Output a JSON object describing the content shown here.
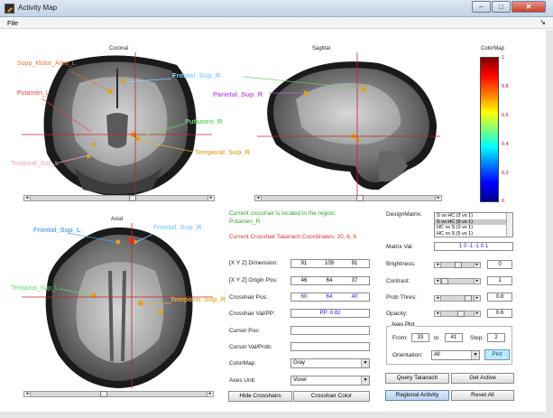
{
  "window": {
    "title": "Activity Map",
    "minimize_glyph": "–",
    "maximize_glyph": "□",
    "close_glyph": "✕"
  },
  "menu": {
    "file_label": "File",
    "overflow_glyph": "↘"
  },
  "views": {
    "coronal": {
      "title": "Coronal",
      "labels": {
        "supp_motor": "Supp_Motor_Area_L",
        "frontal_sup_r": "Frontal_Sup_R",
        "putamen_l": "Putamen_L",
        "putamen_r": "Putamen_R",
        "temporal_sup_r": "Temporal_Sup_R",
        "temporal_sup_l": "Temporal_Sup_L"
      }
    },
    "sagittal": {
      "title": "Sagittal",
      "labels": {
        "parietal_sup_r": "Parietal_Sup_R"
      }
    },
    "axial": {
      "title": "Axial",
      "labels": {
        "frontal_sup_l": "Frontal_Sup_L",
        "frontal_sup_r": "Frontal_Sup_R",
        "temporal_sup_l": "Temporal_Sup_L",
        "temporal_sup_r": "Temporal_Sup_R"
      }
    }
  },
  "colormap": {
    "title": "ColorMap",
    "ticks": [
      "1",
      "0.8",
      "0.6",
      "0.4",
      "0.2",
      "0"
    ],
    "colors": {
      "top": "#800000",
      "bottom": "#00008f"
    }
  },
  "messages": {
    "region_line1": "Current crosshair is located in the region:",
    "region_line2": "Putamen_R",
    "talairach": "Current Crosshair Talairach Coordinates: 20, 6, 6"
  },
  "left_panel": {
    "dimension_label": "[X Y Z] Dimension:",
    "dimension_values": [
      "91",
      "109",
      "91"
    ],
    "origin_label": "[X Y Z] Origin Pos:",
    "origin_values": [
      "46",
      "64",
      "37"
    ],
    "crosshair_pos_label": "Crosshair Pos:",
    "crosshair_pos_values": [
      "60",
      "64",
      "40"
    ],
    "crosshair_val_label": "Crosshair Val/PP:",
    "crosshair_val_value": "PP: 0.82",
    "cursor_pos_label": "Cursor Pos:",
    "cursor_val_label": "Cursor Val/Prob:",
    "colormap_label": "ColorMap:",
    "colormap_value": "Gray",
    "axes_unit_label": "Axes Unit:",
    "axes_unit_value": "Voxel",
    "hide_crosshairs_label": "Hide Crosshairs",
    "crosshair_color_label": "Crosshair Color"
  },
  "right_panel": {
    "design_matrix_label": "DesignMatrix:",
    "design_matrix_options": [
      "S vs HC (3 vs 1)",
      "S vs HC (5 vs 1)",
      "HC vs S (3 vs 1)",
      "HC vs S (5 vs 1)"
    ],
    "matrix_val_label": "Matrix Val:",
    "matrix_val_value": "1 0 -1 -1 0 1",
    "brightness_label": "Brightness:",
    "brightness_value": "0",
    "contrast_label": "Contrast:",
    "contrast_value": "1",
    "prob_thres_label": "Prob Thres:",
    "prob_thres_value": "0.8",
    "opacity_label": "Opacity:",
    "opacity_value": "0.6",
    "axes_plot_title": "Axes Plot",
    "from_label": "From:",
    "from_value": "33",
    "to_label": "to",
    "to_value": "41",
    "step_label": "Step:",
    "step_value": "2",
    "orientation_label": "Orientation:",
    "orientation_value": "All",
    "plot_label": "Plot",
    "query_talairach_label": "Query Talairach",
    "get_active_label": "Get Active",
    "regional_activity_label": "Regional Activity",
    "reset_all_label": "Reset All"
  }
}
